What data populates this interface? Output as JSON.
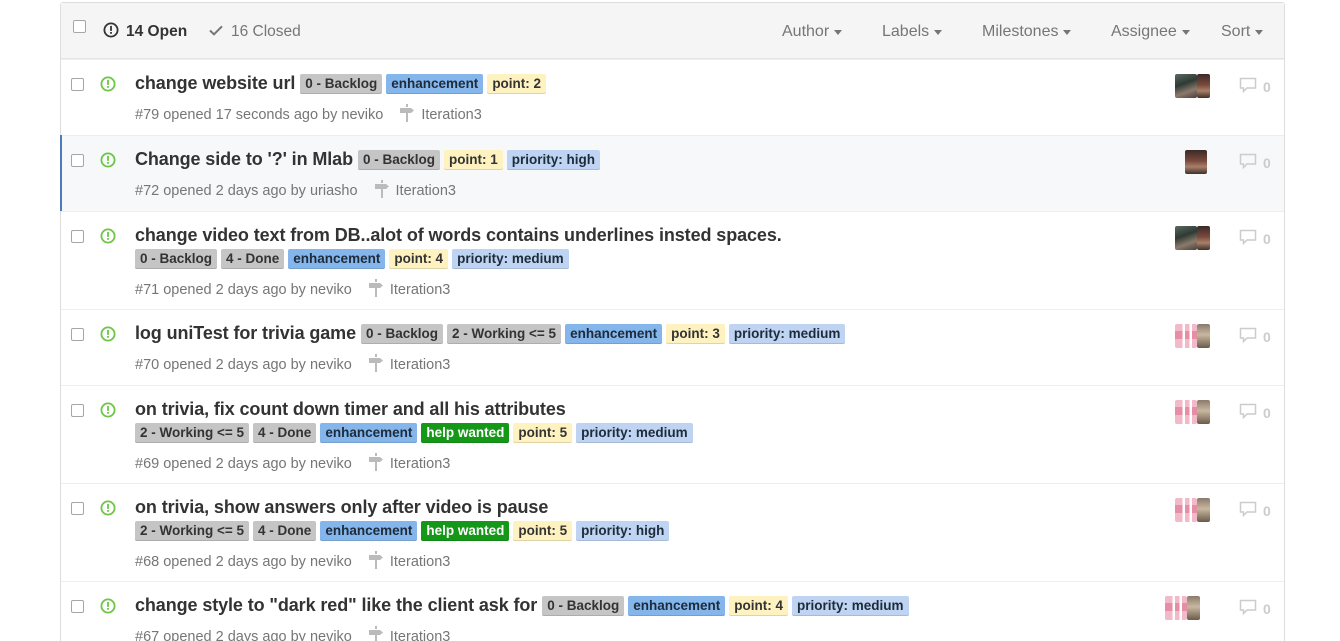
{
  "colors": {
    "open_green": "#6cc644",
    "backlog": "#c5c5c5",
    "working": "#c5c5c5",
    "done": "#c5c5c5",
    "enhancement": "#84b6eb",
    "help_wanted": "#159818",
    "point": "#fef2c0",
    "priority": "#bfd4f2",
    "selected_border": "#4c7cb9"
  },
  "header": {
    "open_label": "14 Open",
    "closed_label": "16 Closed",
    "open_icon": "issue-opened-icon",
    "closed_icon": "check-icon",
    "filters": [
      "Author",
      "Labels",
      "Milestones",
      "Assignee",
      "Sort"
    ]
  },
  "issues": [
    {
      "title": "change website url",
      "labels": [
        "0 - Backlog",
        "enhancement",
        "point: 2"
      ],
      "meta": "#79 opened 17 seconds ago by neviko",
      "milestone": "Iteration3",
      "comments": "0"
    },
    {
      "title": "Change side to '?' in Mlab",
      "labels": [
        "0 - Backlog",
        "point: 1",
        "priority: high"
      ],
      "meta": "#72 opened 2 days ago by uriasho",
      "milestone": "Iteration3",
      "comments": "0"
    },
    {
      "title": "change video text from DB..alot of words contains underlines insted spaces.",
      "labels": [
        "0 - Backlog",
        "4 - Done",
        "enhancement",
        "point: 4",
        "priority: medium"
      ],
      "meta": "#71 opened 2 days ago by neviko",
      "milestone": "Iteration3",
      "comments": "0"
    },
    {
      "title": "log uniTest for trivia game",
      "labels": [
        "0 - Backlog",
        "2 - Working <= 5",
        "enhancement",
        "point: 3",
        "priority: medium"
      ],
      "meta": "#70 opened 2 days ago by neviko",
      "milestone": "Iteration3",
      "comments": "0"
    },
    {
      "title": "on trivia, fix count down timer and all his attributes",
      "labels": [
        "2 - Working <= 5",
        "4 - Done",
        "enhancement",
        "help wanted",
        "point: 5",
        "priority: medium"
      ],
      "meta": "#69 opened 2 days ago by neviko",
      "milestone": "Iteration3",
      "comments": "0"
    },
    {
      "title": "on trivia, show answers only after video is pause",
      "labels": [
        "2 - Working <= 5",
        "4 - Done",
        "enhancement",
        "help wanted",
        "point: 5",
        "priority: high"
      ],
      "meta": "#68 opened 2 days ago by neviko",
      "milestone": "Iteration3",
      "comments": "0"
    },
    {
      "title": "change style to \"dark red\" like the client ask for",
      "labels": [
        "0 - Backlog",
        "enhancement",
        "point: 4",
        "priority: medium"
      ],
      "meta": "#67 opened 2 days ago by neviko",
      "milestone": "Iteration3",
      "comments": "0"
    }
  ]
}
